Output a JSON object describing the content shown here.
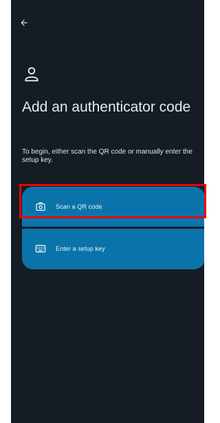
{
  "header": {
    "back_icon": "arrow-left-icon"
  },
  "page": {
    "icon": "person-icon",
    "title": "Add an authenticator code",
    "description": "To begin, either scan the QR code or manually enter the setup key."
  },
  "options": [
    {
      "label": "Scan a QR code",
      "icon": "camera-icon"
    },
    {
      "label": "Enter a setup key",
      "icon": "keyboard-icon"
    }
  ],
  "colors": {
    "background": "#151c24",
    "option_card": "#0a74aa",
    "highlight": "#ee0000",
    "text": "#e6eaf0"
  }
}
